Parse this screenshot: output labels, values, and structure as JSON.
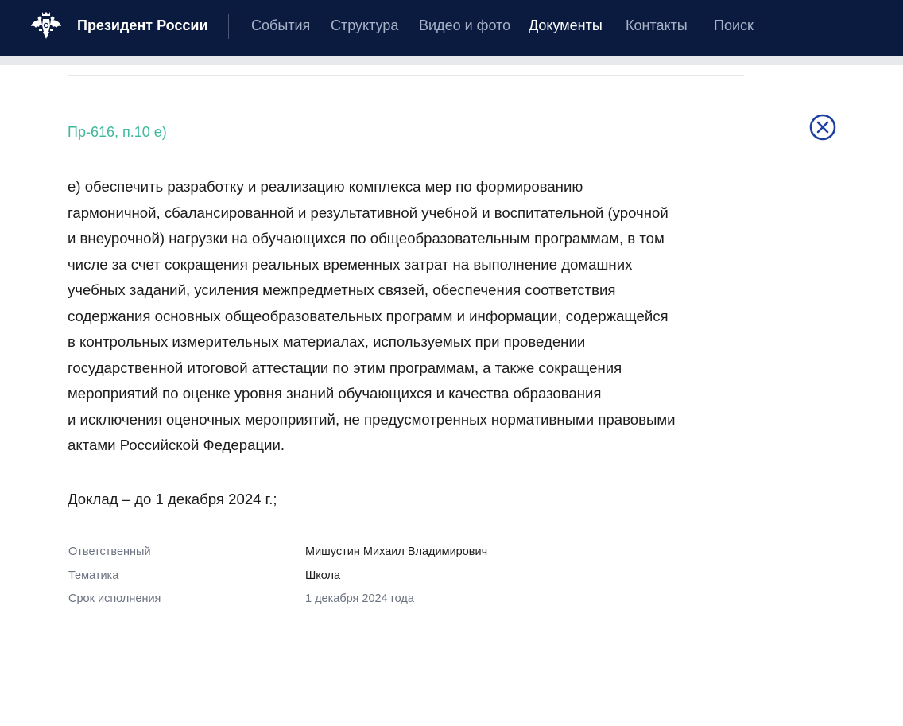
{
  "header": {
    "site_title": "Президент России",
    "nav": [
      {
        "label": "События",
        "active": false
      },
      {
        "label": "Структура",
        "active": false
      },
      {
        "label": "Видео и фото",
        "active": false
      },
      {
        "label": "Документы",
        "active": true
      },
      {
        "label": "Контакты",
        "active": false
      },
      {
        "label": "Поиск",
        "active": false
      }
    ],
    "logo_icon": "double-headed-eagle-icon"
  },
  "instruction": {
    "reference": "Пр-616, п.10 е)",
    "close_icon": "close-circle-icon",
    "lines": [
      "е) обеспечить разработку и реализацию комплекса мер по формированию",
      "гармоничной, сбалансированной и результативной учебной и воспитательной (урочной",
      "и внеурочной) нагрузки на обучающихся по общеобразовательным программам, в том",
      "числе за счет сокращения реальных временных затрат на выполнение домашних",
      "учебных заданий, усиления межпредметных связей, обеспечения соответствия",
      "содержания основных общеобразовательных программ и информации, содержащейся",
      "в контрольных измерительных материалах, используемых при проведении",
      "государственной итоговой аттестации по этим программам, а также сокращения",
      "мероприятий по оценке уровня знаний обучающихся и качества образования",
      "и исключения оценочных мероприятий, не предусмотренных нормативными правовыми",
      "актами Российской Федерации."
    ],
    "deadline_note": "Доклад – до 1 декабря 2024 г.;"
  },
  "meta": [
    {
      "label": "Ответственный",
      "value": "Мишустин Михаил Владимирович"
    },
    {
      "label": "Тематика",
      "value": "Школа"
    },
    {
      "label": "Срок исполнения",
      "value": "1 декабря 2024 года"
    }
  ],
  "colors": {
    "header_bg": "#0b1b3f",
    "accent_green": "#3fb89c",
    "close_blue": "#1d3fa0"
  }
}
